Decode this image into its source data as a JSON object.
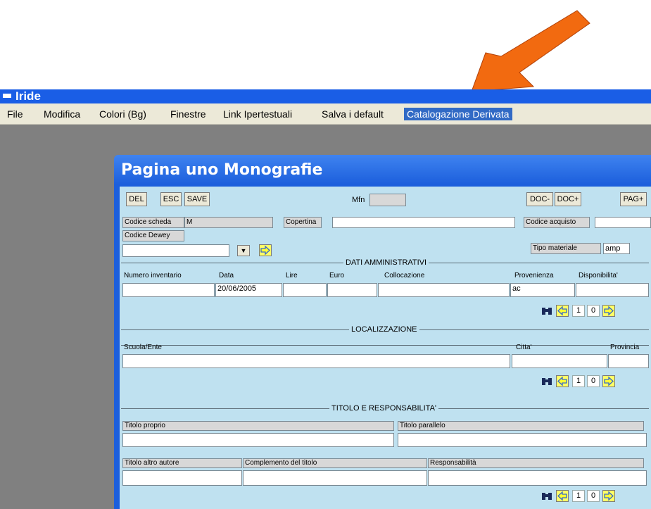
{
  "app": {
    "title": "Iride"
  },
  "menu": [
    "File",
    "Modifica",
    "Colori (Bg)",
    "Finestre",
    "Link Ipertestuali",
    "Salva i default",
    "Catalogazione Derivata"
  ],
  "accent_colors": {
    "titlebar": "#1a5ee6",
    "menu_highlight": "#316ac5",
    "annotation_arrow": "#f26a10",
    "form_bg": "#bfe1f0"
  },
  "window": {
    "title": "Pagina uno Monografie"
  },
  "toolbar": {
    "del": "DEL",
    "esc": "ESC",
    "save": "SAVE",
    "mfn_label": "Mfn",
    "mfn_value": "",
    "doc_minus": "DOC-",
    "doc_plus": "DOC+",
    "pag_plus": "PAG+"
  },
  "header": {
    "codice_scheda_label": "Codice scheda",
    "codice_scheda_value": "M",
    "copertina_label": "Copertina",
    "copertina_value": "",
    "codice_acquisto_label": "Codice acquisto",
    "codice_acquisto_value": "",
    "codice_dewey_label": "Codice Dewey",
    "codice_dewey_value": "",
    "tipo_materiale_label": "Tipo materiale",
    "tipo_materiale_value": "amp"
  },
  "dati_amministrativi": {
    "title": "DATI AMMINISTRATIVI",
    "columns": [
      "Numero inventario",
      "Data",
      "Lire",
      "Euro",
      "Collocazione",
      "Provenienza",
      "Disponibilita'"
    ],
    "row": [
      "",
      "20/06/2005",
      "",
      "",
      "",
      "ac",
      ""
    ],
    "nav": {
      "current": "1",
      "total": "0"
    }
  },
  "localizzazione": {
    "title": "LOCALIZZAZIONE",
    "columns": [
      "Scuola/Ente",
      "Citta'",
      "Provincia"
    ],
    "row": [
      "",
      "",
      ""
    ],
    "nav": {
      "current": "1",
      "total": "0"
    }
  },
  "titolo": {
    "title": "TITOLO E RESPONSABILITA'",
    "row1_columns": [
      "Titolo proprio",
      "Titolo parallelo"
    ],
    "row2_columns": [
      "Titolo altro autore",
      "Complemento del titolo",
      "Responsabilità"
    ],
    "nav": {
      "current": "1",
      "total": "0"
    }
  }
}
